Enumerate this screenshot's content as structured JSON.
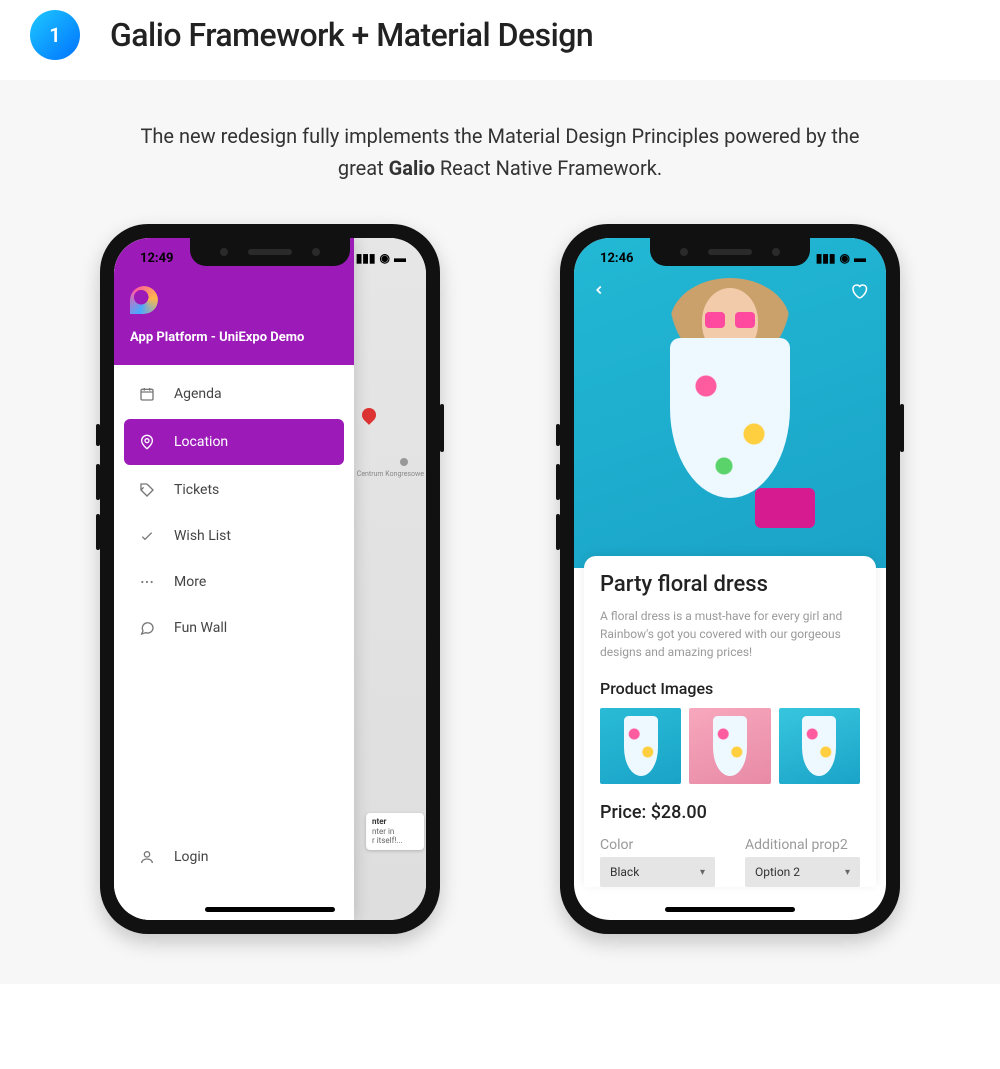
{
  "header": {
    "step": "1",
    "title": "Galio Framework + Material Design",
    "subtitle_pre": "The new redesign fully implements the Material Design Principles powered by the great ",
    "subtitle_bold": "Galio",
    "subtitle_post": " React Native Framework."
  },
  "phone1": {
    "time": "12:49",
    "drawer_title": "App Platform - UniExpo Demo",
    "menu": [
      {
        "label": "Agenda",
        "icon": "calendar"
      },
      {
        "label": "Location",
        "icon": "pin",
        "active": true
      },
      {
        "label": "Tickets",
        "icon": "tag"
      },
      {
        "label": "Wish List",
        "icon": "check"
      },
      {
        "label": "More",
        "icon": "dots"
      },
      {
        "label": "Fun Wall",
        "icon": "chat"
      }
    ],
    "login_label": "Login",
    "map_label": "Centrum Kongresowe",
    "map_card_title": "nter",
    "map_card_line2": "nter in",
    "map_card_line3": "r itself!..."
  },
  "phone2": {
    "time": "12:46",
    "product_title": "Party floral dress",
    "product_desc": "A floral dress is a must-have for every girl and Rainbow's got you covered with our gorgeous designs and amazing prices!",
    "images_title": "Product Images",
    "price_label": "Price: ",
    "price_value": "$28.00",
    "option1_label": "Color",
    "option1_value": "Black",
    "option2_label": "Additional prop2",
    "option2_value": "Option 2"
  }
}
